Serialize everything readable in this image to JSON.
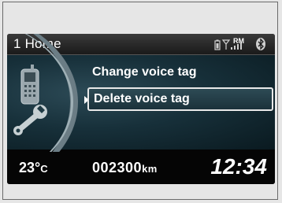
{
  "header": {
    "title": "1 Home",
    "status_icons": [
      "battery-icon",
      "signal-strength-icon",
      "bluetooth-icon"
    ],
    "roaming_label": "RM"
  },
  "menu": {
    "icon": "phone-settings-icon",
    "items": [
      {
        "label": "Change voice tag",
        "selected": false
      },
      {
        "label": "Delete voice tag",
        "selected": true
      }
    ]
  },
  "footer": {
    "temperature_value": "23°",
    "temperature_unit": "C",
    "odometer_value": "002300",
    "odometer_unit": "km",
    "clock": "12:34"
  },
  "colors": {
    "screen_bg": "#050505",
    "panel_bg": "#17303a",
    "text": "#ffffff"
  }
}
